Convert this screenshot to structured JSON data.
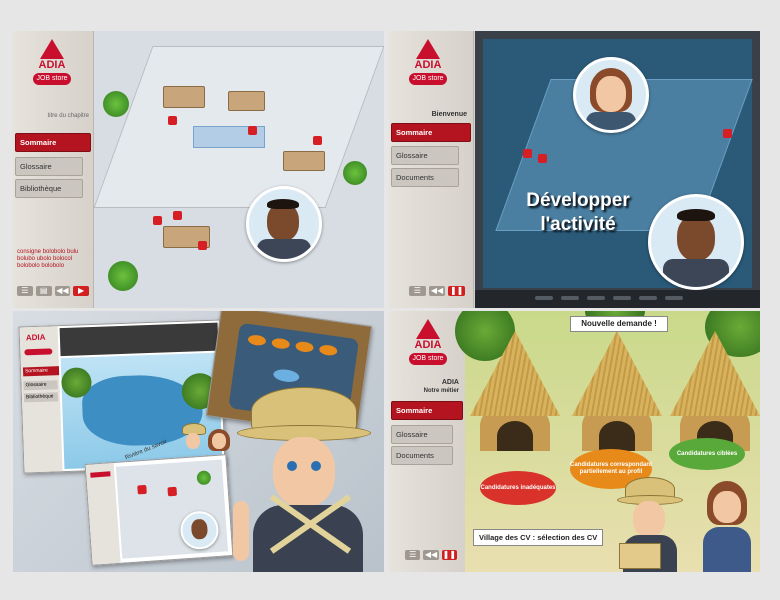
{
  "logo": {
    "brand": "ADIA",
    "sub": "JOB store"
  },
  "panel1": {
    "chapter": "titre du chapitre",
    "nav": [
      "Sommaire",
      "Glossaire",
      "Bibliothèque"
    ],
    "legal": "consigne bolobolo bulu bolubo ubolo bolocol bolobolo bolobolo"
  },
  "panel2": {
    "welcome": "Bienvenue",
    "nav": [
      "Sommaire",
      "Glossaire",
      "Documents"
    ],
    "video_title": "Développer l'activité"
  },
  "panel3": {
    "nav": [
      "Sommaire",
      "Glossaire",
      "Bibliothèque"
    ],
    "map_label": "Rivière du savoir"
  },
  "panel4": {
    "section": "ADIA",
    "subsection": "Notre métier",
    "nav": [
      "Sommaire",
      "Glossaire",
      "Documents"
    ],
    "banner": "Nouvelle demande !",
    "categories": [
      {
        "label": "Candidatures inadéquates",
        "color": "#d9322a"
      },
      {
        "label": "Candidatures correspondant partiellement au profil",
        "color": "#e88a1a"
      },
      {
        "label": "Candidatures ciblées",
        "color": "#58a83a"
      }
    ],
    "caption": "Village des CV : sélection des CV"
  },
  "colors": {
    "brand_red": "#c8102e",
    "sidebar": "#e6e2dc"
  }
}
